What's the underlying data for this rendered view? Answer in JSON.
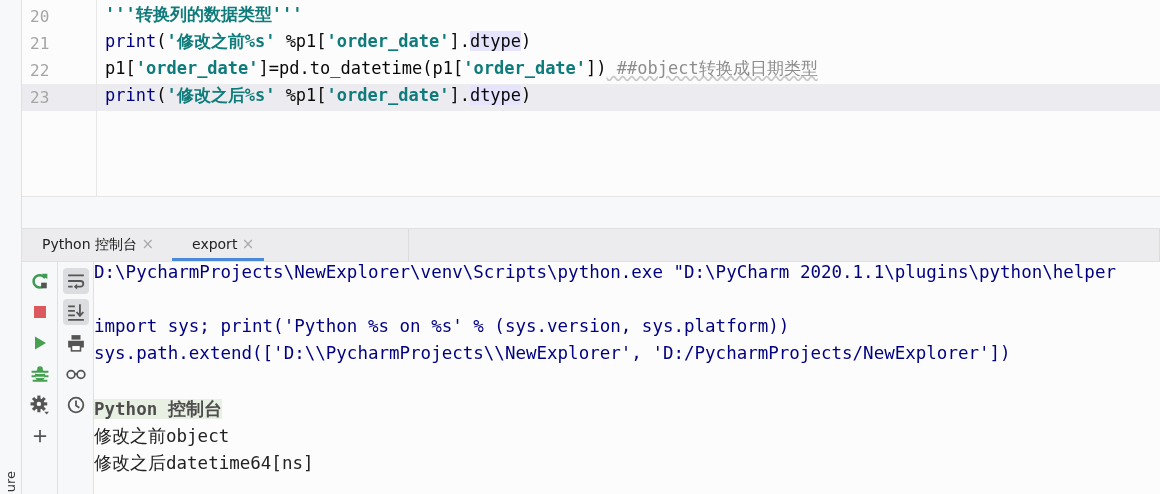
{
  "side_strip": {
    "label": "ure"
  },
  "editor": {
    "lines": [
      {
        "number": "20",
        "current": false,
        "tokens": [
          {
            "kind": "doc",
            "text": "'''转换列的数据类型'''"
          }
        ]
      },
      {
        "number": "21",
        "current": false,
        "tokens": [
          {
            "kind": "builtin",
            "text": "print"
          },
          {
            "kind": "plain",
            "text": "("
          },
          {
            "kind": "string",
            "text": "'修改之前%s'"
          },
          {
            "kind": "plain",
            "text": " %p1["
          },
          {
            "kind": "string",
            "text": "'order_date'"
          },
          {
            "kind": "plain",
            "text": "]."
          },
          {
            "kind": "highlight",
            "text": "dtype"
          },
          {
            "kind": "plain",
            "text": ")"
          }
        ]
      },
      {
        "number": "22",
        "current": false,
        "tokens": [
          {
            "kind": "plain",
            "text": "p1["
          },
          {
            "kind": "string",
            "text": "'order_date'"
          },
          {
            "kind": "plain",
            "text": "]=pd.to_datetime(p1["
          },
          {
            "kind": "string",
            "text": "'order_date'"
          },
          {
            "kind": "plain",
            "text": "])"
          },
          {
            "kind": "comment",
            "text": " ##object转换成日期类型"
          }
        ]
      },
      {
        "number": "23",
        "current": true,
        "tokens": [
          {
            "kind": "builtin",
            "text": "print"
          },
          {
            "kind": "plain",
            "text": "("
          },
          {
            "kind": "string",
            "text": "'修改之后%s'"
          },
          {
            "kind": "plain",
            "text": " %p1["
          },
          {
            "kind": "string",
            "text": "'order_date'"
          },
          {
            "kind": "plain",
            "text": "]."
          },
          {
            "kind": "highlight",
            "text": "dtype"
          },
          {
            "kind": "plain",
            "text": ")"
          }
        ]
      }
    ]
  },
  "tabs": [
    {
      "label": "Python 控制台",
      "close": "×",
      "selected": false
    },
    {
      "label": "export",
      "close": "×",
      "selected": true
    }
  ],
  "run_tools": [
    {
      "kind": "rerun"
    },
    {
      "kind": "stop"
    },
    {
      "kind": "run"
    },
    {
      "kind": "debug"
    },
    {
      "kind": "settings"
    },
    {
      "kind": "add"
    }
  ],
  "view_tools": [
    {
      "kind": "wrap",
      "on": true
    },
    {
      "kind": "scroll-end",
      "on": true
    },
    {
      "kind": "print",
      "on": false
    },
    {
      "kind": "glasses",
      "on": false
    },
    {
      "kind": "history",
      "on": false
    }
  ],
  "console": {
    "lines": [
      {
        "kind": "command",
        "text": "D:\\PycharmProjects\\NewExplorer\\venv\\Scripts\\python.exe \"D:\\PyCharm 2020.1.1\\plugins\\python\\helper"
      },
      {
        "kind": "blank"
      },
      {
        "kind": "command",
        "text": "import sys; print('Python %s on %s' % (sys.version, sys.platform))"
      },
      {
        "kind": "command",
        "text": "sys.path.extend(['D:\\\\PycharmProjects\\\\NewExplorer', 'D:/PycharmProjects/NewExplorer'])"
      },
      {
        "kind": "blank"
      },
      {
        "kind": "banner",
        "text": "Python 控制台"
      },
      {
        "kind": "output",
        "text": "修改之前object"
      },
      {
        "kind": "output",
        "text": "修改之后datetime64[ns]"
      }
    ]
  }
}
